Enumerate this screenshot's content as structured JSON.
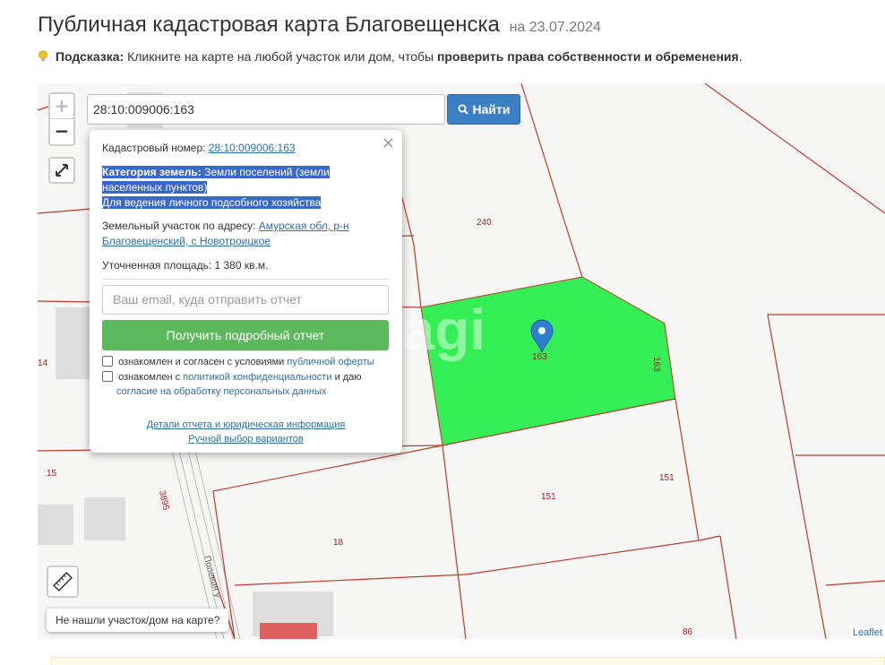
{
  "header": {
    "title": "Публичная кадастровая карта Благовещенска",
    "date": "на 23.07.2024"
  },
  "hint": {
    "label": "Подсказка:",
    "text": "Кликните на карте на любой участок или дом, чтобы",
    "bold_text": "проверить права собственности и обременения",
    "end": "."
  },
  "map": {
    "zoom_in": "+",
    "zoom_out": "−",
    "search_value": "28:10:009006:163",
    "search_button": "Найти",
    "parcel_labels": [
      "240",
      "14",
      "15",
      "3895",
      "151",
      "151",
      "18",
      "86",
      "163",
      "163"
    ],
    "street_label": "Полевая у",
    "watermark": "eagi",
    "not_found": "Не нашли участок/дом на карте?",
    "attribution": "Leaflet",
    "colors": {
      "selected_parcel": "#33ee55",
      "boundary": "#c0392b",
      "pin": "#2f7fd1"
    }
  },
  "popup": {
    "close": "×",
    "cadastral_label": "Кадастровый номер:",
    "cadastral_value": "28:10:009006:163",
    "category_label": "Категория земель:",
    "category_value": "Земли поселений (земли населенных пунктов)",
    "usage": "Для ведения личного подсобного хозяйства",
    "address_label": "Земельный участок по адресу:",
    "address_value": "Амурская обл, р-н Благовещенский, с Новотроицкое",
    "area_label": "Уточненная площадь:",
    "area_value": "1 380 кв.м.",
    "email_placeholder": "Ваш email, куда отправить отчет",
    "report_button": "Получить подробный отчет",
    "consent1_text": "ознакомлен и согласен с условиями",
    "consent1_link": "публичной оферты",
    "consent2_text": "ознакомлен с",
    "consent2_link": "политикой конфиденциальности",
    "consent2_mid": "и даю",
    "consent2_link2": "согласие на обработку персональных данных",
    "details_link": "Детали отчета и юридическая информация",
    "manual_link": "Ручной выбор вариантов"
  }
}
